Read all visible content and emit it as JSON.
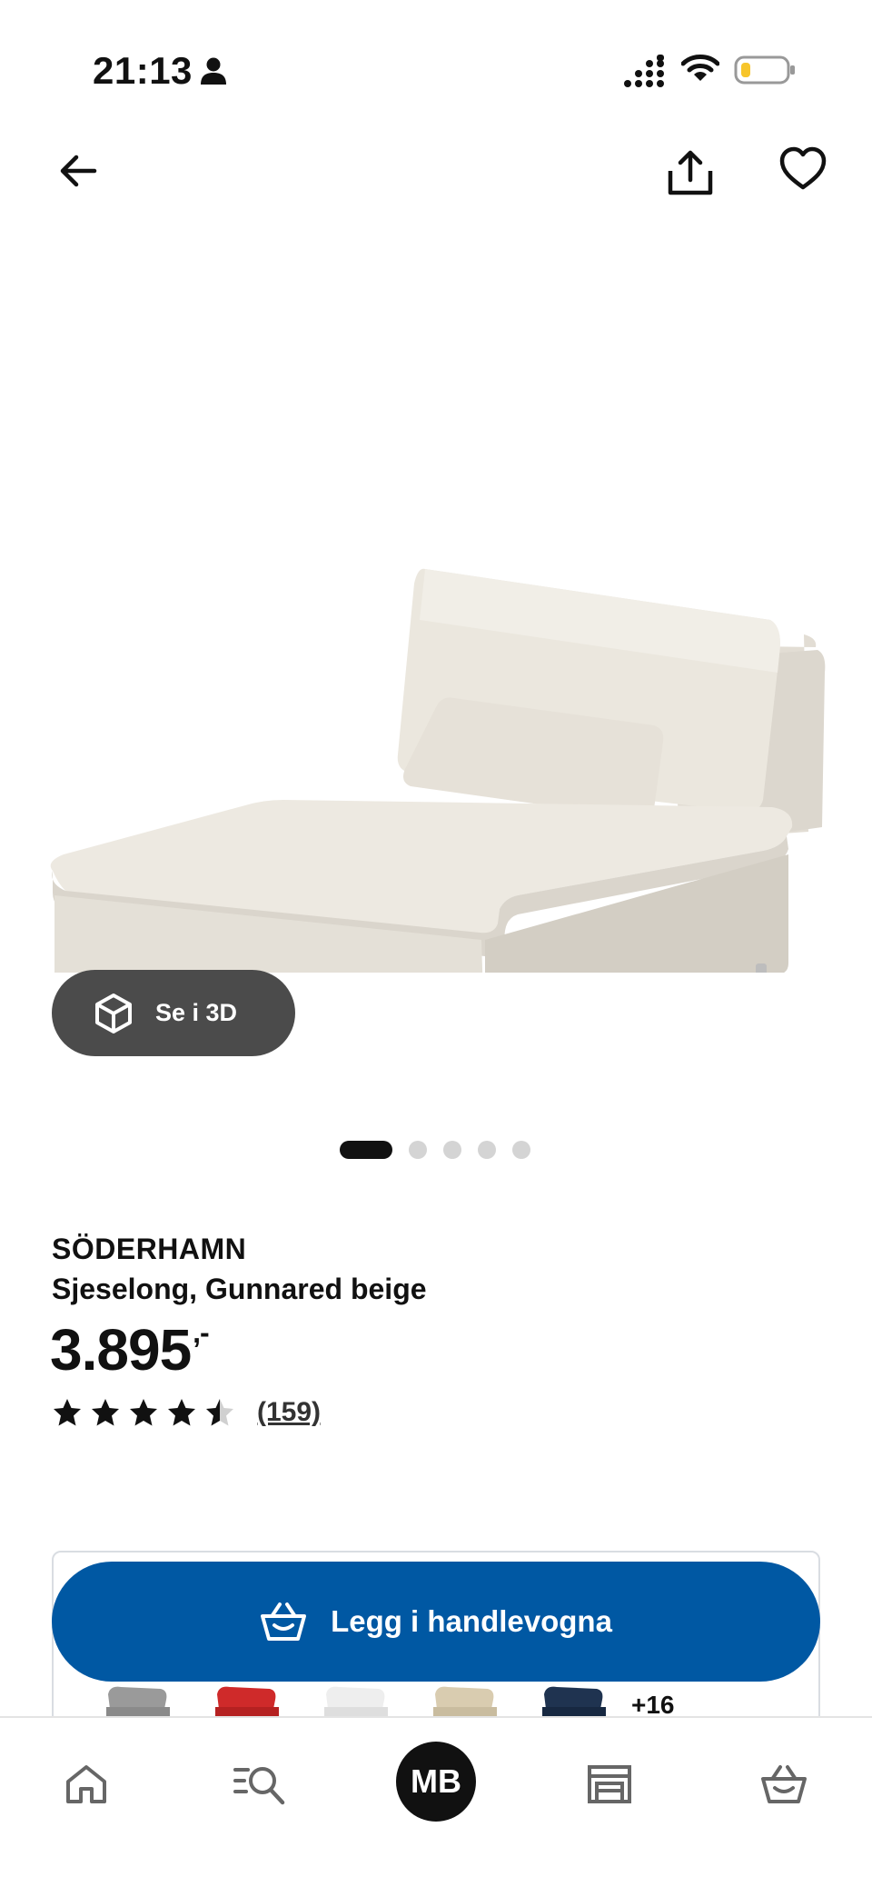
{
  "status_bar": {
    "time": "21:13",
    "icons": [
      "person-icon",
      "cellular-signal-icon",
      "wifi-icon",
      "battery-low-icon"
    ],
    "battery_color": "#f7c52b"
  },
  "top_nav": {
    "icons": [
      "back-arrow-icon",
      "share-icon",
      "heart-icon"
    ]
  },
  "hero": {
    "image": "beige-chaise-longue-sofa",
    "view_3d_label": "Se i 3D",
    "carousel": {
      "current": 1,
      "total": 5
    }
  },
  "product": {
    "brand": "SÖDERHAMN",
    "subtitle": "Sjeselong, Gunnared beige",
    "price": "3.895",
    "price_suffix": ",-",
    "rating": {
      "value": 4.5,
      "max": 5
    },
    "review_count": "(159)"
  },
  "cart": {
    "add_label": "Legg i handlevogna",
    "button_color": "#0058a3",
    "variant_colors": [
      "#9a9a9a",
      "#cf2a2a",
      "#eeeeee",
      "#d9ccb0",
      "#1f3350"
    ],
    "more_variants": "+16"
  },
  "bottom_nav": {
    "items": [
      "home-icon",
      "search-catalog-icon",
      "profile-avatar",
      "store-icon",
      "cart-icon"
    ],
    "avatar_initials": "MB"
  }
}
